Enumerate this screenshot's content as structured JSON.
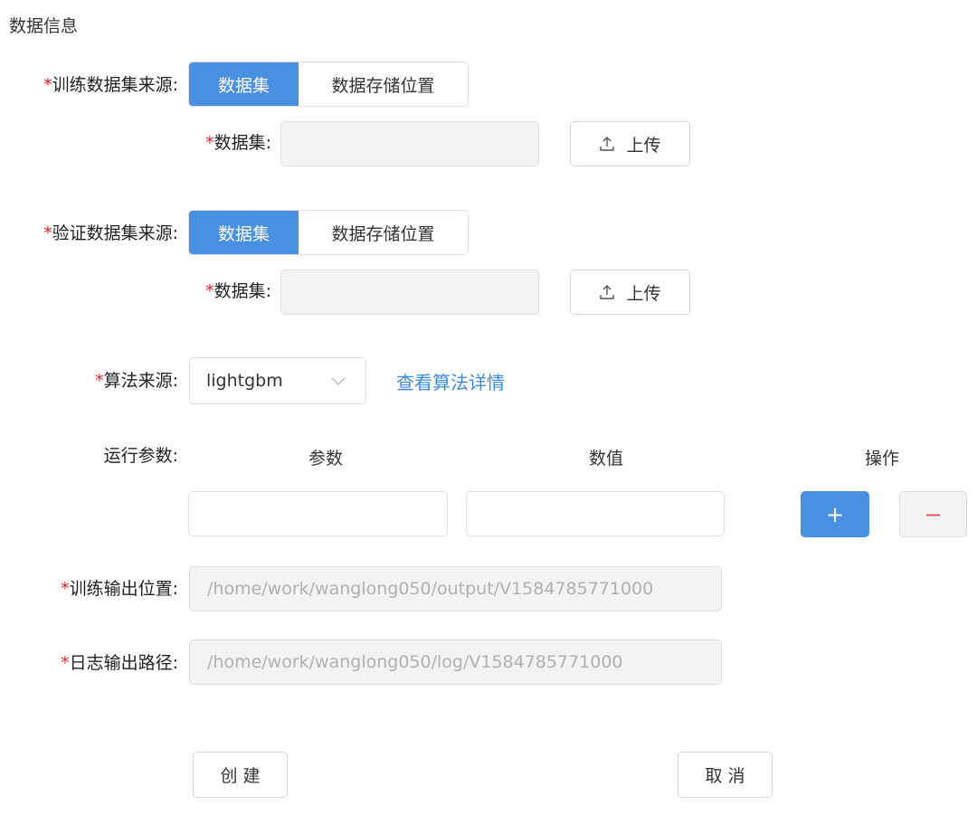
{
  "section": {
    "title": "数据信息"
  },
  "train": {
    "label": "训练数据集来源:",
    "seg_dataset": "数据集",
    "seg_storage": "数据存储位置",
    "dataset_label": "数据集:",
    "upload_label": "上传",
    "dataset_value": ""
  },
  "validate": {
    "label": "验证数据集来源:",
    "seg_dataset": "数据集",
    "seg_storage": "数据存储位置",
    "dataset_label": "数据集:",
    "upload_label": "上传",
    "dataset_value": ""
  },
  "algorithm": {
    "label": "算法来源:",
    "selected": "lightgbm",
    "detail_link": "查看算法详情"
  },
  "params": {
    "label": "运行参数:",
    "col_param": "参数",
    "col_value": "数值",
    "col_action": "操作",
    "add": "+",
    "remove": "−"
  },
  "train_output": {
    "label": "训练输出位置:",
    "value": "/home/work/wanglong050/output/V1584785771000"
  },
  "log_output": {
    "label": "日志输出路径:",
    "value": "/home/work/wanglong050/log/V1584785771000"
  },
  "actions": {
    "create": "创 建",
    "cancel": "取 消"
  },
  "required_mark": "*",
  "colors": {
    "primary": "#4a90e2",
    "required": "#e02020",
    "link": "#3b8be0"
  }
}
